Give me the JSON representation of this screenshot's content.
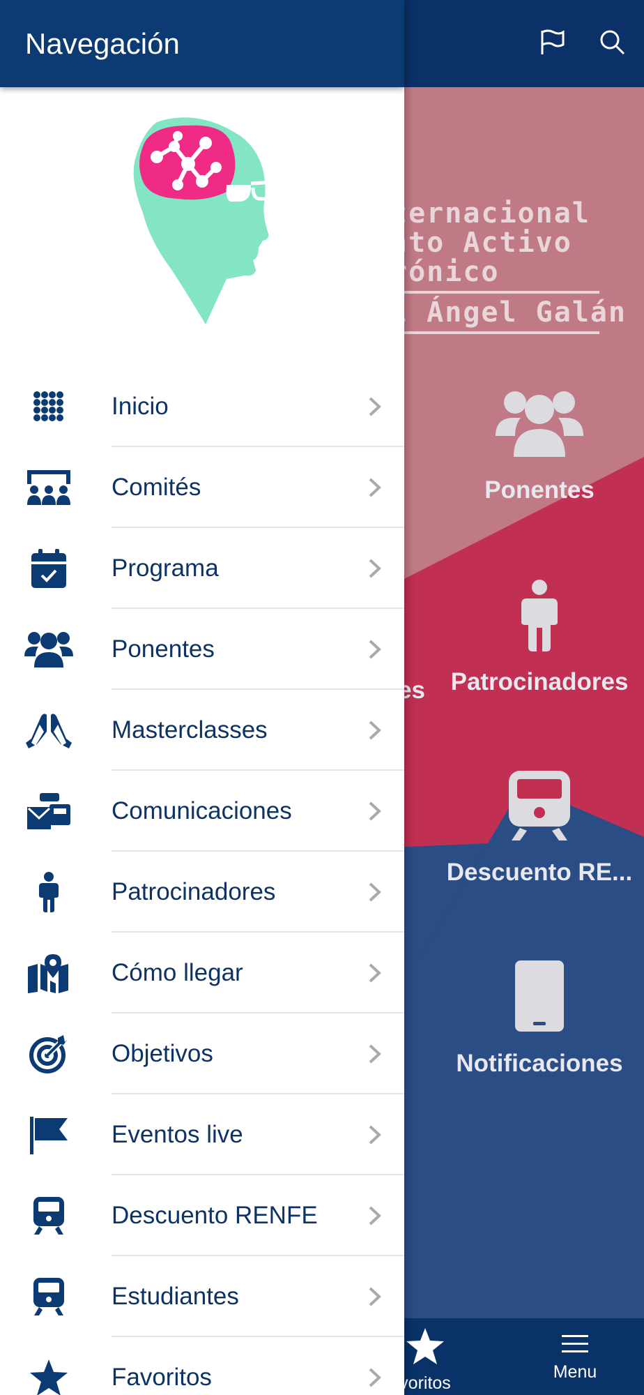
{
  "colors": {
    "primary": "#0b3b72",
    "accent_pink": "#c12f52",
    "accent_pink_light": "#c07a86",
    "accent_blue": "#2a4d86",
    "logo_green": "#83e5c3",
    "logo_pink": "#ef2b86"
  },
  "drawer": {
    "title": "Navegación",
    "logo": "brain-head-logo",
    "items": [
      {
        "label": "Inicio",
        "icon": "grid-icon"
      },
      {
        "label": "Comités",
        "icon": "committee-icon"
      },
      {
        "label": "Programa",
        "icon": "calendar-check-icon"
      },
      {
        "label": "Ponentes",
        "icon": "users-icon"
      },
      {
        "label": "Masterclasses",
        "icon": "hands-icon"
      },
      {
        "label": "Comunicaciones",
        "icon": "mail-bulk-icon"
      },
      {
        "label": "Patrocinadores",
        "icon": "person-icon"
      },
      {
        "label": "Cómo llegar",
        "icon": "map-marker-icon"
      },
      {
        "label": "Objetivos",
        "icon": "target-icon"
      },
      {
        "label": "Eventos live",
        "icon": "flag-icon"
      },
      {
        "label": "Descuento RENFE",
        "icon": "train-icon"
      },
      {
        "label": "Estudiantes",
        "icon": "train-icon"
      },
      {
        "label": "Favoritos",
        "icon": "star-icon"
      }
    ]
  },
  "background": {
    "header_icons": [
      "flag-outline-icon",
      "search-icon"
    ],
    "banner_lines": [
      "ternacional",
      "nto Activo",
      "rónico",
      "l Ángel Galán"
    ],
    "tiles": [
      {
        "label": "Ponentes",
        "icon": "users-icon"
      },
      {
        "label": "es",
        "icon": ""
      },
      {
        "label": "Patrocinadores",
        "icon": "person-icon"
      },
      {
        "label": "Descuento RE...",
        "icon": "train-icon"
      },
      {
        "label": "Notificaciones",
        "icon": "mobile-icon"
      }
    ],
    "tabbar": [
      {
        "label": "voritos",
        "icon": "star-icon"
      },
      {
        "label": "Menu",
        "icon": "hamburger-icon"
      }
    ]
  }
}
